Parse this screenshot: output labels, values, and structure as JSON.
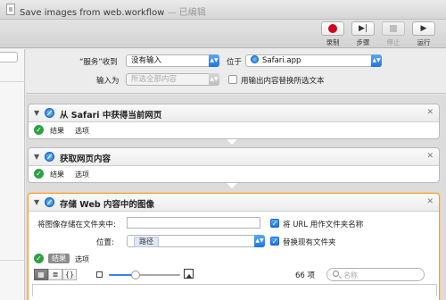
{
  "window": {
    "title": "Save images from web.workflow",
    "separator": "—",
    "edited": "已编辑"
  },
  "toolbar": {
    "record": "录制",
    "step": "步骤",
    "stop": "停止",
    "run": "运行"
  },
  "settings": {
    "service_receives_label": "“服务”收到",
    "service_receives_value": "没有输入",
    "in_label": "位于",
    "app_value": "Safari.app",
    "input_is_label": "输入为",
    "input_is_value": "所选全部内容",
    "replace_label": "用输出内容替换所选文本"
  },
  "actions": [
    {
      "title": "从 Safari 中获得当前网页",
      "results": "结果",
      "options": "选项"
    },
    {
      "title": "获取网页内容",
      "results": "结果",
      "options": "选项"
    },
    {
      "title": "存储 Web 内容中的图像",
      "results": "结果",
      "options": "选项"
    }
  ],
  "save_action": {
    "save_to_label": "将图像存储在文件夹中:",
    "use_url_label": "将 URL 用作文件夹名称",
    "location_label": "位置:",
    "location_token": "路径",
    "replace_existing_label": "替换现有文件夹"
  },
  "results_bar": {
    "list_glyph": "≣",
    "code_glyph": "{}",
    "count": "66 项",
    "search_placeholder": "名称",
    "zoom_fraction": 0.38
  },
  "colors": {
    "accent": "#1f74e6",
    "record": "#d0021b",
    "ok": "#2ea043",
    "selected_border": "#f0a03a"
  }
}
